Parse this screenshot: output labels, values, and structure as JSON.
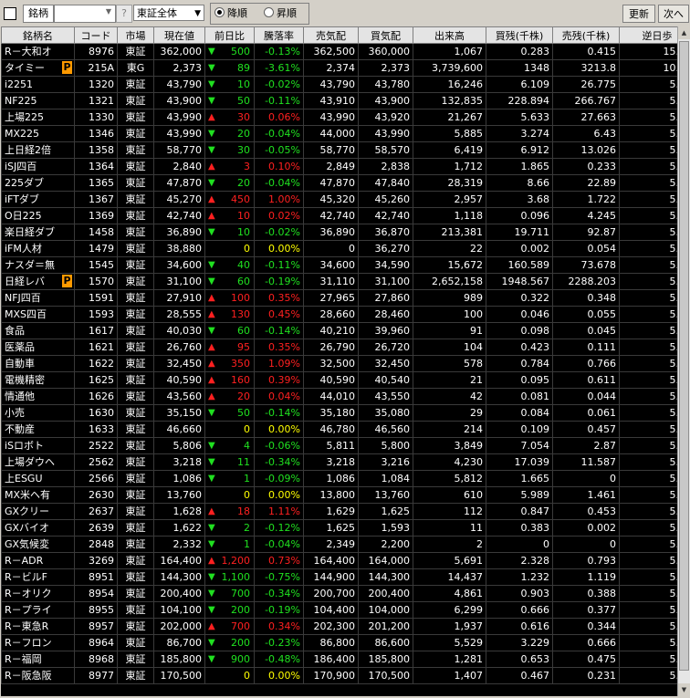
{
  "toolbar": {
    "label": "銘柄",
    "code_value": "",
    "question": "?",
    "market_select": "東証全体",
    "sort_desc": "降順",
    "sort_asc": "昇順",
    "refresh": "更新",
    "next": "次へ"
  },
  "columns": [
    "銘柄名",
    "コード",
    "市場",
    "現在値",
    "前日比",
    "騰落率",
    "売気配",
    "買気配",
    "出来高",
    "買残(千株)",
    "売残(千株)",
    "逆日歩"
  ],
  "rows": [
    {
      "name": "R－大和オ",
      "badge": "",
      "code": "8976",
      "market": "東証",
      "price": "362,000",
      "dir": "dn",
      "chg": "500",
      "rate": "-0.13%",
      "ask": "362,500",
      "bid": "360,000",
      "vol": "1,067",
      "buy": "0.283",
      "sell": "0.415",
      "gyaku": "15.00"
    },
    {
      "name": "タイミー",
      "badge": "P",
      "code": "215A",
      "market": "東G",
      "price": "2,373",
      "dir": "dn",
      "chg": "89",
      "rate": "-3.61%",
      "ask": "2,374",
      "bid": "2,373",
      "vol": "3,739,600",
      "buy": "1348",
      "sell": "3213.8",
      "gyaku": "10.00"
    },
    {
      "name": "i2251",
      "badge": "",
      "code": "1320",
      "market": "東証",
      "price": "43,790",
      "dir": "dn",
      "chg": "10",
      "rate": "-0.02%",
      "ask": "43,790",
      "bid": "43,780",
      "vol": "16,246",
      "buy": "6.109",
      "sell": "26.775",
      "gyaku": "5.00"
    },
    {
      "name": "NF225",
      "badge": "",
      "code": "1321",
      "market": "東証",
      "price": "43,900",
      "dir": "dn",
      "chg": "50",
      "rate": "-0.11%",
      "ask": "43,910",
      "bid": "43,900",
      "vol": "132,835",
      "buy": "228.894",
      "sell": "266.767",
      "gyaku": "5.00"
    },
    {
      "name": "上場225",
      "badge": "",
      "code": "1330",
      "market": "東証",
      "price": "43,990",
      "dir": "up",
      "chg": "30",
      "rate": "0.06%",
      "ask": "43,990",
      "bid": "43,920",
      "vol": "21,267",
      "buy": "5.633",
      "sell": "27.663",
      "gyaku": "5.00"
    },
    {
      "name": "MX225",
      "badge": "",
      "code": "1346",
      "market": "東証",
      "price": "43,990",
      "dir": "dn",
      "chg": "20",
      "rate": "-0.04%",
      "ask": "44,000",
      "bid": "43,990",
      "vol": "5,885",
      "buy": "3.274",
      "sell": "6.43",
      "gyaku": "5.00"
    },
    {
      "name": "上日経2倍",
      "badge": "",
      "code": "1358",
      "market": "東証",
      "price": "58,770",
      "dir": "dn",
      "chg": "30",
      "rate": "-0.05%",
      "ask": "58,770",
      "bid": "58,570",
      "vol": "6,419",
      "buy": "6.912",
      "sell": "13.026",
      "gyaku": "5.00"
    },
    {
      "name": "iSJ四百",
      "badge": "",
      "code": "1364",
      "market": "東証",
      "price": "2,840",
      "dir": "up",
      "chg": "3",
      "rate": "0.10%",
      "ask": "2,849",
      "bid": "2,838",
      "vol": "1,712",
      "buy": "1.865",
      "sell": "0.233",
      "gyaku": "5.00"
    },
    {
      "name": "225ダブ",
      "badge": "",
      "code": "1365",
      "market": "東証",
      "price": "47,870",
      "dir": "dn",
      "chg": "20",
      "rate": "-0.04%",
      "ask": "47,870",
      "bid": "47,840",
      "vol": "28,319",
      "buy": "8.66",
      "sell": "22.89",
      "gyaku": "5.00"
    },
    {
      "name": "iFTダブ",
      "badge": "",
      "code": "1367",
      "market": "東証",
      "price": "45,270",
      "dir": "up",
      "chg": "450",
      "rate": "1.00%",
      "ask": "45,320",
      "bid": "45,260",
      "vol": "2,957",
      "buy": "3.68",
      "sell": "1.722",
      "gyaku": "5.00"
    },
    {
      "name": "O日225",
      "badge": "",
      "code": "1369",
      "market": "東証",
      "price": "42,740",
      "dir": "up",
      "chg": "10",
      "rate": "0.02%",
      "ask": "42,740",
      "bid": "42,740",
      "vol": "1,118",
      "buy": "0.096",
      "sell": "4.245",
      "gyaku": "5.00"
    },
    {
      "name": "楽日経ダブ",
      "badge": "",
      "code": "1458",
      "market": "東証",
      "price": "36,890",
      "dir": "dn",
      "chg": "10",
      "rate": "-0.02%",
      "ask": "36,890",
      "bid": "36,870",
      "vol": "213,381",
      "buy": "19.711",
      "sell": "92.87",
      "gyaku": "5.00"
    },
    {
      "name": "iFM人材",
      "badge": "",
      "code": "1479",
      "market": "東証",
      "price": "38,880",
      "dir": "zero",
      "chg": "0",
      "rate": "0.00%",
      "ask": "0",
      "bid": "36,270",
      "vol": "22",
      "buy": "0.002",
      "sell": "0.054",
      "gyaku": "5.00"
    },
    {
      "name": "ナスダ＝無",
      "badge": "",
      "code": "1545",
      "market": "東証",
      "price": "34,600",
      "dir": "dn",
      "chg": "40",
      "rate": "-0.11%",
      "ask": "34,600",
      "bid": "34,590",
      "vol": "15,672",
      "buy": "160.589",
      "sell": "73.678",
      "gyaku": "5.00"
    },
    {
      "name": "日経レバ",
      "badge": "P",
      "code": "1570",
      "market": "東証",
      "price": "31,100",
      "dir": "dn",
      "chg": "60",
      "rate": "-0.19%",
      "ask": "31,110",
      "bid": "31,100",
      "vol": "2,652,158",
      "buy": "1948.567",
      "sell": "2288.203",
      "gyaku": "5.00"
    },
    {
      "name": "NFJ四百",
      "badge": "",
      "code": "1591",
      "market": "東証",
      "price": "27,910",
      "dir": "up",
      "chg": "100",
      "rate": "0.35%",
      "ask": "27,965",
      "bid": "27,860",
      "vol": "989",
      "buy": "0.322",
      "sell": "0.348",
      "gyaku": "5.00"
    },
    {
      "name": "MXS四百",
      "badge": "",
      "code": "1593",
      "market": "東証",
      "price": "28,555",
      "dir": "up",
      "chg": "130",
      "rate": "0.45%",
      "ask": "28,660",
      "bid": "28,460",
      "vol": "100",
      "buy": "0.046",
      "sell": "0.055",
      "gyaku": "5.00"
    },
    {
      "name": "食品",
      "badge": "",
      "code": "1617",
      "market": "東証",
      "price": "40,030",
      "dir": "dn",
      "chg": "60",
      "rate": "-0.14%",
      "ask": "40,210",
      "bid": "39,960",
      "vol": "91",
      "buy": "0.098",
      "sell": "0.045",
      "gyaku": "5.00"
    },
    {
      "name": "医薬品",
      "badge": "",
      "code": "1621",
      "market": "東証",
      "price": "26,760",
      "dir": "up",
      "chg": "95",
      "rate": "0.35%",
      "ask": "26,790",
      "bid": "26,720",
      "vol": "104",
      "buy": "0.423",
      "sell": "0.111",
      "gyaku": "5.00"
    },
    {
      "name": "自動車",
      "badge": "",
      "code": "1622",
      "market": "東証",
      "price": "32,450",
      "dir": "up",
      "chg": "350",
      "rate": "1.09%",
      "ask": "32,500",
      "bid": "32,450",
      "vol": "578",
      "buy": "0.784",
      "sell": "0.766",
      "gyaku": "5.00"
    },
    {
      "name": "電機精密",
      "badge": "",
      "code": "1625",
      "market": "東証",
      "price": "40,590",
      "dir": "up",
      "chg": "160",
      "rate": "0.39%",
      "ask": "40,590",
      "bid": "40,540",
      "vol": "21",
      "buy": "0.095",
      "sell": "0.611",
      "gyaku": "5.00"
    },
    {
      "name": "情通他",
      "badge": "",
      "code": "1626",
      "market": "東証",
      "price": "43,560",
      "dir": "up",
      "chg": "20",
      "rate": "0.04%",
      "ask": "44,010",
      "bid": "43,550",
      "vol": "42",
      "buy": "0.081",
      "sell": "0.044",
      "gyaku": "5.00"
    },
    {
      "name": "小売",
      "badge": "",
      "code": "1630",
      "market": "東証",
      "price": "35,150",
      "dir": "dn",
      "chg": "50",
      "rate": "-0.14%",
      "ask": "35,180",
      "bid": "35,080",
      "vol": "29",
      "buy": "0.084",
      "sell": "0.061",
      "gyaku": "5.00"
    },
    {
      "name": "不動産",
      "badge": "",
      "code": "1633",
      "market": "東証",
      "price": "46,660",
      "dir": "zero",
      "chg": "0",
      "rate": "0.00%",
      "ask": "46,780",
      "bid": "46,560",
      "vol": "214",
      "buy": "0.109",
      "sell": "0.457",
      "gyaku": "5.00"
    },
    {
      "name": "iSロボト",
      "badge": "",
      "code": "2522",
      "market": "東証",
      "price": "5,806",
      "dir": "dn",
      "chg": "4",
      "rate": "-0.06%",
      "ask": "5,811",
      "bid": "5,800",
      "vol": "3,849",
      "buy": "7.054",
      "sell": "2.87",
      "gyaku": "5.00"
    },
    {
      "name": "上場ダウヘ",
      "badge": "",
      "code": "2562",
      "market": "東証",
      "price": "3,218",
      "dir": "dn",
      "chg": "11",
      "rate": "-0.34%",
      "ask": "3,218",
      "bid": "3,216",
      "vol": "4,230",
      "buy": "17.039",
      "sell": "11.587",
      "gyaku": "5.00"
    },
    {
      "name": "上ESGU",
      "badge": "",
      "code": "2566",
      "market": "東証",
      "price": "1,086",
      "dir": "dn",
      "chg": "1",
      "rate": "-0.09%",
      "ask": "1,086",
      "bid": "1,084",
      "vol": "5,812",
      "buy": "1.665",
      "sell": "0",
      "gyaku": "5.00"
    },
    {
      "name": "MX米ヘ有",
      "badge": "",
      "code": "2630",
      "market": "東証",
      "price": "13,760",
      "dir": "zero",
      "chg": "0",
      "rate": "0.00%",
      "ask": "13,800",
      "bid": "13,760",
      "vol": "610",
      "buy": "5.989",
      "sell": "1.461",
      "gyaku": "5.00"
    },
    {
      "name": "GXクリー",
      "badge": "",
      "code": "2637",
      "market": "東証",
      "price": "1,628",
      "dir": "up",
      "chg": "18",
      "rate": "1.11%",
      "ask": "1,629",
      "bid": "1,625",
      "vol": "112",
      "buy": "0.847",
      "sell": "0.453",
      "gyaku": "5.00"
    },
    {
      "name": "GXバイオ",
      "badge": "",
      "code": "2639",
      "market": "東証",
      "price": "1,622",
      "dir": "dn",
      "chg": "2",
      "rate": "-0.12%",
      "ask": "1,625",
      "bid": "1,593",
      "vol": "11",
      "buy": "0.383",
      "sell": "0.002",
      "gyaku": "5.00"
    },
    {
      "name": "GX気候変",
      "badge": "",
      "code": "2848",
      "market": "東証",
      "price": "2,332",
      "dir": "dn",
      "chg": "1",
      "rate": "-0.04%",
      "ask": "2,349",
      "bid": "2,200",
      "vol": "2",
      "buy": "0",
      "sell": "0",
      "gyaku": "5.00"
    },
    {
      "name": "R－ADR",
      "badge": "",
      "code": "3269",
      "market": "東証",
      "price": "164,400",
      "dir": "up",
      "chg": "1,200",
      "rate": "0.73%",
      "ask": "164,400",
      "bid": "164,000",
      "vol": "5,691",
      "buy": "2.328",
      "sell": "0.793",
      "gyaku": "5.00"
    },
    {
      "name": "R－ビルF",
      "badge": "",
      "code": "8951",
      "market": "東証",
      "price": "144,300",
      "dir": "dn",
      "chg": "1,100",
      "rate": "-0.75%",
      "ask": "144,900",
      "bid": "144,300",
      "vol": "14,437",
      "buy": "1.232",
      "sell": "1.119",
      "gyaku": "5.00"
    },
    {
      "name": "R－オリク",
      "badge": "",
      "code": "8954",
      "market": "東証",
      "price": "200,400",
      "dir": "dn",
      "chg": "700",
      "rate": "-0.34%",
      "ask": "200,700",
      "bid": "200,400",
      "vol": "4,861",
      "buy": "0.903",
      "sell": "0.388",
      "gyaku": "5.00"
    },
    {
      "name": "R－プライ",
      "badge": "",
      "code": "8955",
      "market": "東証",
      "price": "104,100",
      "dir": "dn",
      "chg": "200",
      "rate": "-0.19%",
      "ask": "104,400",
      "bid": "104,000",
      "vol": "6,299",
      "buy": "0.666",
      "sell": "0.377",
      "gyaku": "5.00"
    },
    {
      "name": "R－東急R",
      "badge": "",
      "code": "8957",
      "market": "東証",
      "price": "202,000",
      "dir": "up",
      "chg": "700",
      "rate": "0.34%",
      "ask": "202,300",
      "bid": "201,200",
      "vol": "1,937",
      "buy": "0.616",
      "sell": "0.344",
      "gyaku": "5.00"
    },
    {
      "name": "R－フロン",
      "badge": "",
      "code": "8964",
      "market": "東証",
      "price": "86,700",
      "dir": "dn",
      "chg": "200",
      "rate": "-0.23%",
      "ask": "86,800",
      "bid": "86,600",
      "vol": "5,529",
      "buy": "3.229",
      "sell": "0.666",
      "gyaku": "5.00"
    },
    {
      "name": "R－福岡",
      "badge": "",
      "code": "8968",
      "market": "東証",
      "price": "185,800",
      "dir": "dn",
      "chg": "900",
      "rate": "-0.48%",
      "ask": "186,400",
      "bid": "185,800",
      "vol": "1,281",
      "buy": "0.653",
      "sell": "0.475",
      "gyaku": "5.00"
    },
    {
      "name": "R－阪急阪",
      "badge": "",
      "code": "8977",
      "market": "東証",
      "price": "170,500",
      "dir": "zero",
      "chg": "0",
      "rate": "0.00%",
      "ask": "170,900",
      "bid": "170,500",
      "vol": "1,407",
      "buy": "0.467",
      "sell": "0.231",
      "gyaku": "5.00"
    }
  ]
}
